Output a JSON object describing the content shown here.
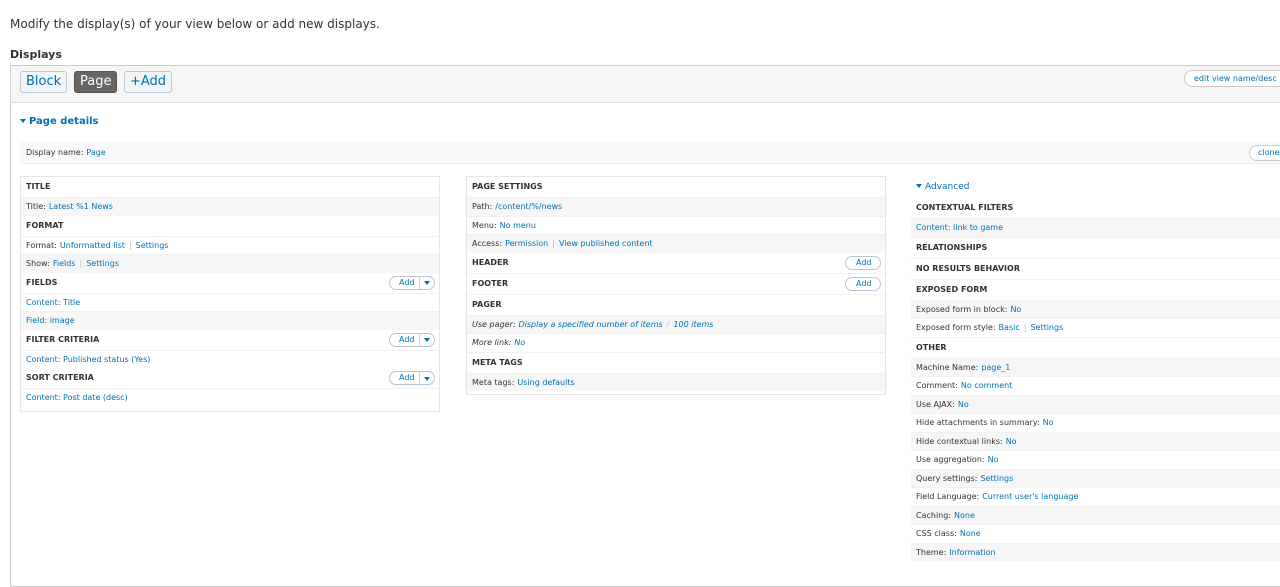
{
  "intro": "Modify the display(s) of your view below or add new displays.",
  "displays_heading": "Displays",
  "tabs": {
    "block": "Block",
    "page": "Page",
    "add": "+Add"
  },
  "edit_name": "edit view name/desc",
  "page_details": "Page details",
  "display_name": {
    "label": "Display name:",
    "value": "Page"
  },
  "clone": "clone",
  "add_label": "Add",
  "col1": {
    "title": {
      "heading": "TITLE",
      "label": "Title:",
      "value": "Latest %1 News"
    },
    "format": {
      "heading": "FORMAT",
      "format_label": "Format:",
      "format_value": "Unformatted list",
      "format_settings": "Settings",
      "show_label": "Show:",
      "show_value": "Fields",
      "show_settings": "Settings"
    },
    "fields": {
      "heading": "FIELDS",
      "items": [
        "Content: Title",
        "Field: image"
      ]
    },
    "filter": {
      "heading": "FILTER CRITERIA",
      "items": [
        "Content: Published status (Yes)"
      ]
    },
    "sort": {
      "heading": "SORT CRITERIA",
      "items": [
        "Content: Post date (desc)"
      ]
    }
  },
  "col2": {
    "page_settings": {
      "heading": "PAGE SETTINGS",
      "path_label": "Path:",
      "path_value": "/content/%/news",
      "menu_label": "Menu:",
      "menu_value": "No menu",
      "access_label": "Access:",
      "access_value": "Permission",
      "access_extra": "View published content"
    },
    "header": "HEADER",
    "footer": "FOOTER",
    "pager": {
      "heading": "PAGER",
      "use_label": "Use pager:",
      "use_value": "Display a specified number of items",
      "use_extra": "100 items",
      "more_label": "More link:",
      "more_value": "No"
    },
    "meta": {
      "heading": "META TAGS",
      "label": "Meta tags:",
      "value": "Using defaults"
    }
  },
  "col3": {
    "advanced": "Advanced",
    "contextual": {
      "heading": "CONTEXTUAL FILTERS",
      "item": "Content: link to game"
    },
    "relationships": "RELATIONSHIPS",
    "no_results": "NO RESULTS BEHAVIOR",
    "exposed": {
      "heading": "EXPOSED FORM",
      "block_label": "Exposed form in block:",
      "block_value": "No",
      "style_label": "Exposed form style:",
      "style_value": "Basic",
      "style_settings": "Settings"
    },
    "other": {
      "heading": "OTHER",
      "rows": [
        {
          "label": "Machine Name:",
          "value": "page_1"
        },
        {
          "label": "Comment:",
          "value": "No comment"
        },
        {
          "label": "Use AJAX:",
          "value": "No"
        },
        {
          "label": "Hide attachments in summary:",
          "value": "No"
        },
        {
          "label": "Hide contextual links:",
          "value": "No"
        },
        {
          "label": "Use aggregation:",
          "value": "No"
        },
        {
          "label": "Query settings:",
          "value": "Settings"
        },
        {
          "label": "Field Language:",
          "value": "Current user's language"
        },
        {
          "label": "Caching:",
          "value": "None"
        },
        {
          "label": "CSS class:",
          "value": "None"
        },
        {
          "label": "Theme:",
          "value": "Information"
        }
      ]
    }
  }
}
